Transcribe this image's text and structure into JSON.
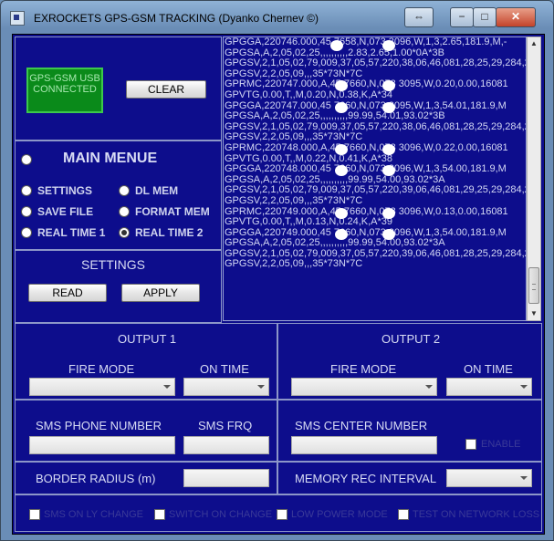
{
  "window": {
    "title": "EXROCKETS  GPS-GSM TRACKING  (Dyanko Chernev ©)",
    "buttons": {
      "swap": "⇔",
      "minimize": "−",
      "maximize": "□",
      "close": "✕"
    }
  },
  "status": {
    "text": "GPS-GSM USB CONNECTED",
    "color": "#0a8a1a"
  },
  "clear_label": "CLEAR",
  "menu": {
    "title": "MAIN MENUE",
    "options": [
      {
        "label": "SETTINGS",
        "checked": false
      },
      {
        "label": "DL MEM",
        "checked": false
      },
      {
        "label": "SAVE FILE",
        "checked": false
      },
      {
        "label": "FORMAT MEM",
        "checked": false
      },
      {
        "label": "REAL TIME 1",
        "checked": false
      },
      {
        "label": "REAL TIME 2",
        "checked": true
      }
    ]
  },
  "settings": {
    "title": "SETTINGS",
    "read_label": "READ",
    "apply_label": "APPLY"
  },
  "log_lines": [
    "GPGGA,220746.000,45  7658,N,073  3096,W,1,3,2.65,181.9,M,-",
    "GPGSA,A,2,05,02,25,,,,,,,,,,2.83,2.65,1.00*0A*3B",
    "GPGSV,2,1,05,02,79,009,37,05,57,220,38,06,46,081,28,25,29,284,2",
    "GPGSV,2,2,05,09,,,35*73N*7C",
    "GPRMC,220747.000,A,45  7660,N,073  3095,W,0.20,0.00,16081",
    "GPVTG,0.00,T,,M,0.20,N,0.38,K,A*34",
    "GPGGA,220747.000,45  7660,N,073  3095,W,1,3,54.01,181.9,M",
    "GPGSA,A,2,05,02,25,,,,,,,,,,99.99,54.01,93.02*3B",
    "GPGSV,2,1,05,02,79,009,37,05,57,220,38,06,46,081,28,25,29,284,2",
    "GPGSV,2,2,05,09,,,35*73N*7C",
    "GPRMC,220748.000,A,45  7660,N,073  3096,W,0.22,0.00,16081",
    "GPVTG,0.00,T,,M,0.22,N,0.41,K,A*38",
    "GPGGA,220748.000,45  7660,N,073  3096,W,1,3,54.00,181.9,M",
    "GPGSA,A,2,05,02,25,,,,,,,,,,99.99,54.00,93.02*3A",
    "GPGSV,2,1,05,02,79,009,37,05,57,220,39,06,46,081,29,25,29,284,2",
    "GPGSV,2,2,05,09,,,35*73N*7C",
    "GPRMC,220749.000,A,45  7660,N,073  3096,W,0.13,0.00,16081",
    "GPVTG,0.00,T,,M,0.13,N,0.24,K,A*39",
    "GPGGA,220749.000,45  7660,N,073  3096,W,1,3,54.00,181.9,M",
    "GPGSA,A,2,05,02,25,,,,,,,,,,99.99,54.00,93.02*3A",
    "GPGSV,2,1,05,02,79,009,37,05,57,220,39,06,46,081,28,25,29,284,2",
    "GPGSV,2,2,05,09,,,35*73N*7C"
  ],
  "output1": {
    "title": "OUTPUT 1",
    "fire_mode_label": "FIRE MODE",
    "on_time_label": "ON TIME"
  },
  "output2": {
    "title": "OUTPUT 2",
    "fire_mode_label": "FIRE MODE",
    "on_time_label": "ON TIME"
  },
  "sms": {
    "phone_label": "SMS PHONE NUMBER",
    "frq_label": "SMS FRQ",
    "center_label": "SMS CENTER NUMBER",
    "enable_label": "ENABLE"
  },
  "border_label": "BORDER RADIUS (m)",
  "memory_label": "MEMORY REC INTERVAL",
  "bottom_checks": [
    "SMS ON LY CHANGE",
    "SWITCH ON CHANGE",
    "LOW POWER MODE",
    "TEST ON NETWORK LOSS"
  ]
}
